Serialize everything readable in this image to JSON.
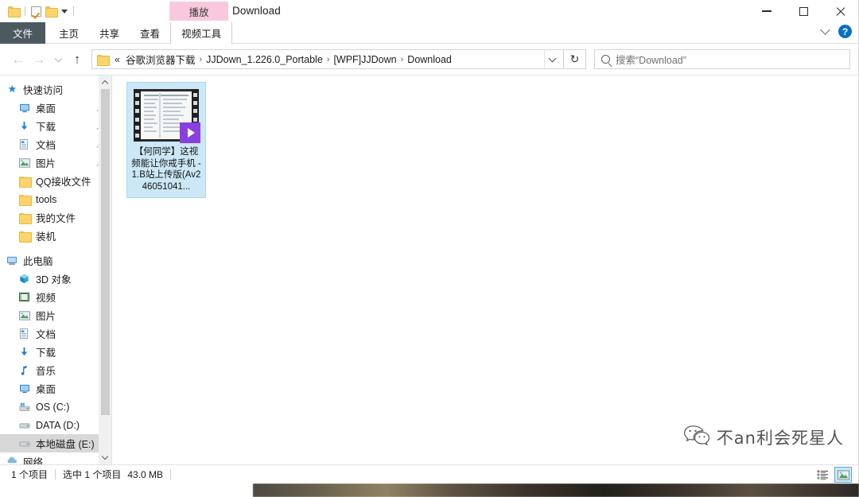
{
  "window": {
    "title": "Download",
    "controls": {
      "minimize": "−",
      "maximize": "□",
      "close": "×"
    }
  },
  "quick_access_toolbar": {
    "items": [
      {
        "name": "properties-folder-icon",
        "label": ""
      },
      {
        "name": "new-folder-checkbox-icon",
        "label": ""
      },
      {
        "name": "new-folder-icon",
        "label": ""
      }
    ]
  },
  "ribbon": {
    "contextual_tab_group": "视频工具",
    "contextual_tab": "播放",
    "tabs": [
      {
        "label": "文件",
        "active": true
      },
      {
        "label": "主页",
        "active": false
      },
      {
        "label": "共享",
        "active": false
      },
      {
        "label": "查看",
        "active": false
      }
    ],
    "help_label": "?"
  },
  "navbar": {
    "back": "←",
    "forward": "→",
    "recent": "⌄",
    "up": "↑",
    "refresh": "↻",
    "overflow": "«",
    "breadcrumbs": [
      "谷歌浏览器下载",
      "JJDown_1.226.0_Portable",
      "[WPF]JJDown",
      "Download"
    ],
    "separator": "›"
  },
  "search": {
    "placeholder": "搜索“Download”",
    "icon": "search-icon"
  },
  "sidebar": {
    "sections": [
      {
        "name": "quick-access",
        "label": "快速访问",
        "icon": "star-icon",
        "items": [
          {
            "label": "桌面",
            "icon": "desktop-icon",
            "pinned": true
          },
          {
            "label": "下载",
            "icon": "download-icon",
            "pinned": true
          },
          {
            "label": "文档",
            "icon": "documents-icon",
            "pinned": true
          },
          {
            "label": "图片",
            "icon": "pictures-icon",
            "pinned": true
          },
          {
            "label": "QQ接收文件",
            "icon": "folder-icon",
            "pinned": false
          },
          {
            "label": "tools",
            "icon": "folder-icon",
            "pinned": false
          },
          {
            "label": "我的文件",
            "icon": "folder-icon",
            "pinned": false
          },
          {
            "label": "装机",
            "icon": "folder-icon",
            "pinned": false
          }
        ]
      },
      {
        "name": "this-pc",
        "label": "此电脑",
        "icon": "computer-icon",
        "items": [
          {
            "label": "3D 对象",
            "icon": "3d-objects-icon",
            "pinned": false
          },
          {
            "label": "视频",
            "icon": "videos-icon",
            "pinned": false
          },
          {
            "label": "图片",
            "icon": "pictures-icon",
            "pinned": false
          },
          {
            "label": "文档",
            "icon": "documents-icon",
            "pinned": false
          },
          {
            "label": "下载",
            "icon": "download-icon",
            "pinned": false
          },
          {
            "label": "音乐",
            "icon": "music-icon",
            "pinned": false
          },
          {
            "label": "桌面",
            "icon": "desktop-icon",
            "pinned": false
          },
          {
            "label": "OS (C:)",
            "icon": "os-drive-icon",
            "pinned": false
          },
          {
            "label": "DATA (D:)",
            "icon": "drive-icon",
            "pinned": false
          },
          {
            "label": "本地磁盘 (E:)",
            "icon": "drive-icon",
            "pinned": false,
            "selected": true
          }
        ]
      },
      {
        "name": "network",
        "label": "网络",
        "icon": "network-icon",
        "items": []
      }
    ]
  },
  "files": [
    {
      "name": "【何同学】这视频能让你戒手机 - 1.B站上传版(Av246051041...",
      "type": "video",
      "selected": true,
      "badge_icon": "play-badge-icon"
    }
  ],
  "statusbar": {
    "item_count": "1 个项目",
    "selection": "选中 1 个项目",
    "size": "43.0 MB",
    "views": [
      {
        "name": "details-view-button",
        "active": false
      },
      {
        "name": "large-icons-view-button",
        "active": true
      }
    ]
  },
  "watermark": {
    "text": "不an利会死星人",
    "icon": "wechat-icon"
  },
  "colors": {
    "accent": "#0a6fc2",
    "selection": "#cce8f6",
    "selection_border": "#a8d8ef",
    "contextual_tab": "#f8c9dd",
    "file_tab": "#4c5a60",
    "play_badge": "#8a3fe0",
    "folder_yellow": "#fbd46d"
  }
}
